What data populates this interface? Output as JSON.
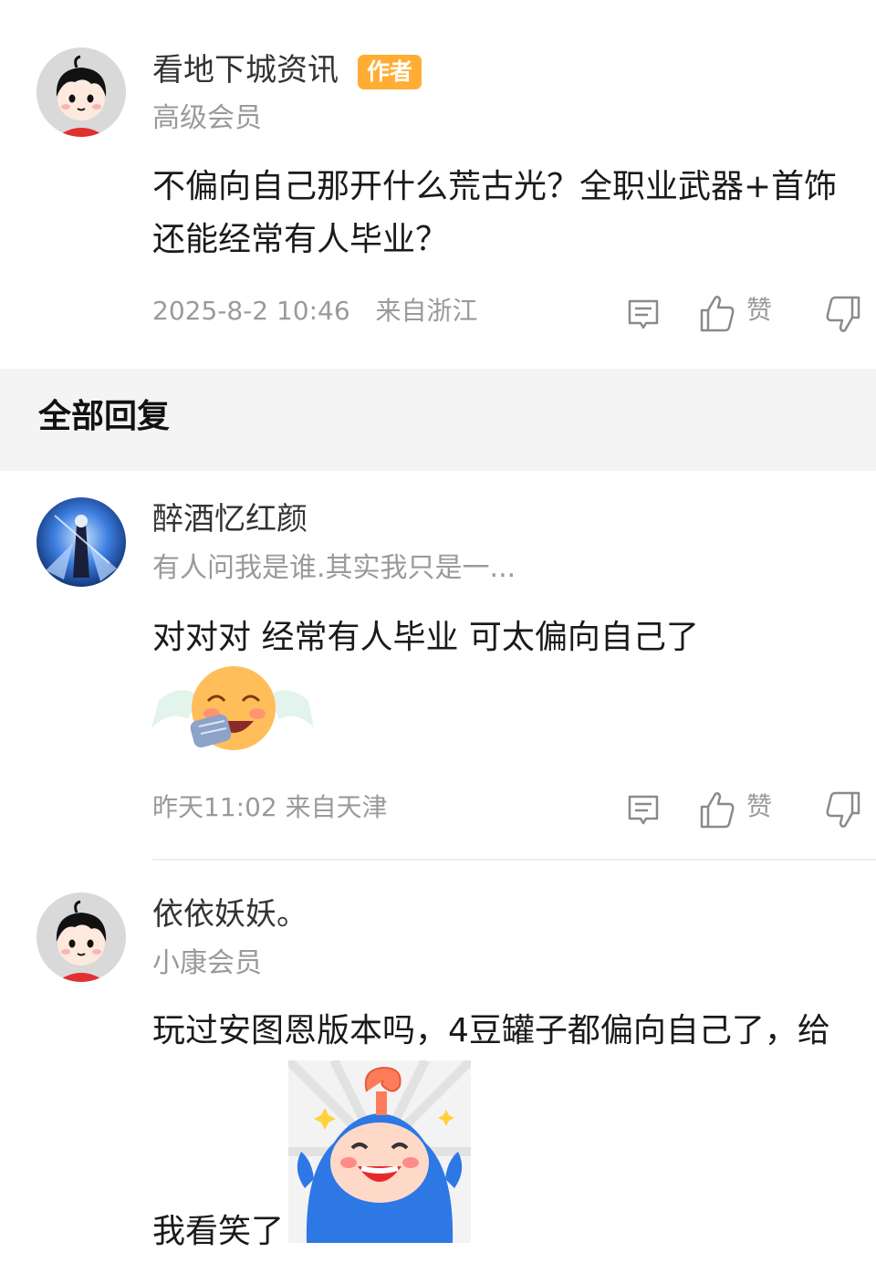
{
  "post": {
    "author_name": "看地下城资讯",
    "author_badge": "作者",
    "author_level": "高级会员",
    "content_line1": "不偏向自己那开什么荒古光？全职业武器+首饰",
    "content_line2": "还能经常有人毕业？",
    "timestamp": "2025-8-2 10:46",
    "location": "来自浙江",
    "like_label": "赞"
  },
  "section": {
    "title": "全部回复"
  },
  "replies": [
    {
      "author_name": "醉酒忆红颜",
      "author_sub": "有人问我是谁.其实我只是一...",
      "content": "对对对 经常有人毕业 可太偏向自己了",
      "sticker": "crying-laughing-emoji",
      "timestamp": "昨天11:02",
      "location": "来自天津",
      "like_label": "赞"
    },
    {
      "author_name": "依依妖妖。",
      "author_sub": "小康会员",
      "content_line1": "玩过安图恩版本吗，4豆罐子都偏向自己了，给",
      "content_line2": "我看笑了",
      "sticker": "blue-mascot-laughing-sticker"
    }
  ],
  "icons": {
    "comment": "comment-icon",
    "like": "thumbs-up-icon",
    "dislike": "thumbs-down-icon"
  },
  "colors": {
    "badge": "#ffad33",
    "section_bg": "#f4f4f4",
    "meta_text": "#9a9a9a"
  }
}
